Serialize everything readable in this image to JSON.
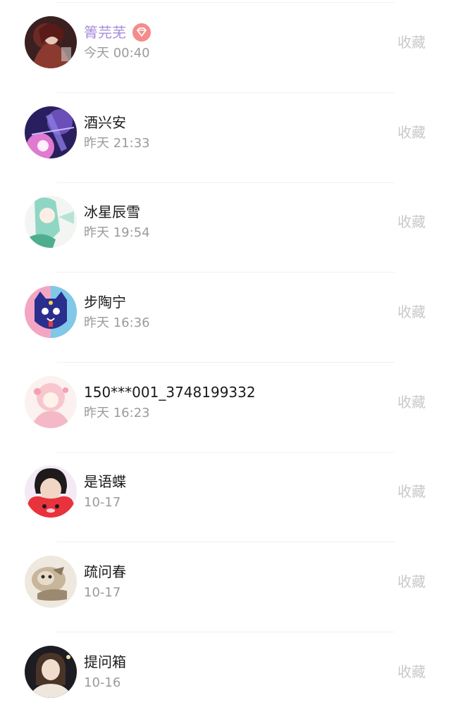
{
  "accent_color": "#a98ad8",
  "badge_color": "#f58b8b",
  "users": [
    {
      "name": "箐芫芜",
      "time": "今天 00:40",
      "action": "收藏",
      "vip": true,
      "avatar": "avatar-dark-red-hair"
    },
    {
      "name": "酒兴安",
      "time": "昨天 21:33",
      "action": "收藏",
      "vip": false,
      "avatar": "avatar-purple-anime"
    },
    {
      "name": "冰星辰雪",
      "time": "昨天 19:54",
      "action": "收藏",
      "vip": false,
      "avatar": "avatar-green-anime"
    },
    {
      "name": "步陶宁",
      "time": "昨天 16:36",
      "action": "收藏",
      "vip": false,
      "avatar": "avatar-blue-cat"
    },
    {
      "name": "150***001_3748199332",
      "time": "昨天 16:23",
      "action": "收藏",
      "vip": false,
      "avatar": "avatar-pink-anime"
    },
    {
      "name": "是语蝶",
      "time": "10-17",
      "action": "收藏",
      "vip": false,
      "avatar": "avatar-boy-heart"
    },
    {
      "name": "疏问春",
      "time": "10-17",
      "action": "收藏",
      "vip": false,
      "avatar": "avatar-cat-photo"
    },
    {
      "name": "提问箱",
      "time": "10-16",
      "action": "收藏",
      "vip": false,
      "avatar": "avatar-girl-photo"
    }
  ]
}
